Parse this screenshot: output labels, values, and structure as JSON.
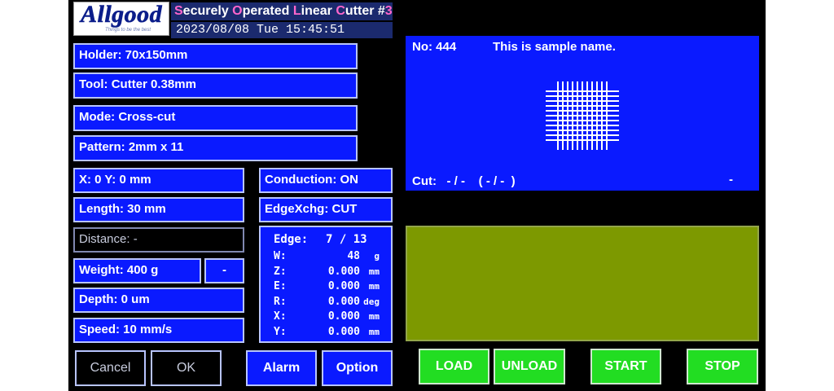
{
  "header": {
    "logo_text": "Allgood",
    "logo_sub": "Things to be the best",
    "title_segments": [
      {
        "text": "S",
        "hl": true
      },
      {
        "text": "ecurely ",
        "hl": false
      },
      {
        "text": "O",
        "hl": true
      },
      {
        "text": "perated ",
        "hl": false
      },
      {
        "text": "L",
        "hl": true
      },
      {
        "text": "inear ",
        "hl": false
      },
      {
        "text": "C",
        "hl": true
      },
      {
        "text": "utter #",
        "hl": false
      },
      {
        "text": "3",
        "hl": true
      }
    ],
    "datetime": "2023/08/08 Tue 15:45:51"
  },
  "fields": {
    "holder": "Holder: 70x150mm",
    "tool": "Tool: Cutter 0.38mm",
    "mode": "Mode: Cross-cut",
    "pattern": "Pattern: 2mm x 11",
    "xy": "X: 0  Y: 0 mm",
    "length": "Length: 30 mm",
    "distance": "Distance: -",
    "weight": "Weight: 400 g",
    "weight_btn": "-",
    "depth": "Depth: 0 um",
    "speed": "Speed: 10 mm/s",
    "conduction": "Conduction: ON",
    "edge_xchg": "EdgeXchg: CUT"
  },
  "edge_panel": {
    "edge_label": "Edge:",
    "edge_value": "7 / 13",
    "rows": [
      {
        "label": "W:",
        "value": "48",
        "unit": "g"
      },
      {
        "label": "Z:",
        "value": "0.000",
        "unit": "mm"
      },
      {
        "label": "E:",
        "value": "0.000",
        "unit": "mm"
      },
      {
        "label": "R:",
        "value": "0.000",
        "unit": "deg"
      },
      {
        "label": "X:",
        "value": "0.000",
        "unit": "mm"
      },
      {
        "label": "Y:",
        "value": "0.000",
        "unit": "mm"
      }
    ]
  },
  "preview": {
    "number": "No: 444",
    "name": "This is sample name.",
    "cut": "Cut:   - / -    ( - / -  )",
    "status": "-",
    "grid_lines": 11
  },
  "buttons": {
    "cancel": "Cancel",
    "ok": "OK",
    "alarm": "Alarm",
    "option": "Option",
    "load": "LOAD",
    "unload": "UNLOAD",
    "start": "START",
    "stop": "STOP"
  },
  "colors": {
    "field_blue": "#0a1aff",
    "button_green": "#22dd22",
    "display_olive": "#7d9900",
    "title_highlight": "#ff66cc"
  }
}
